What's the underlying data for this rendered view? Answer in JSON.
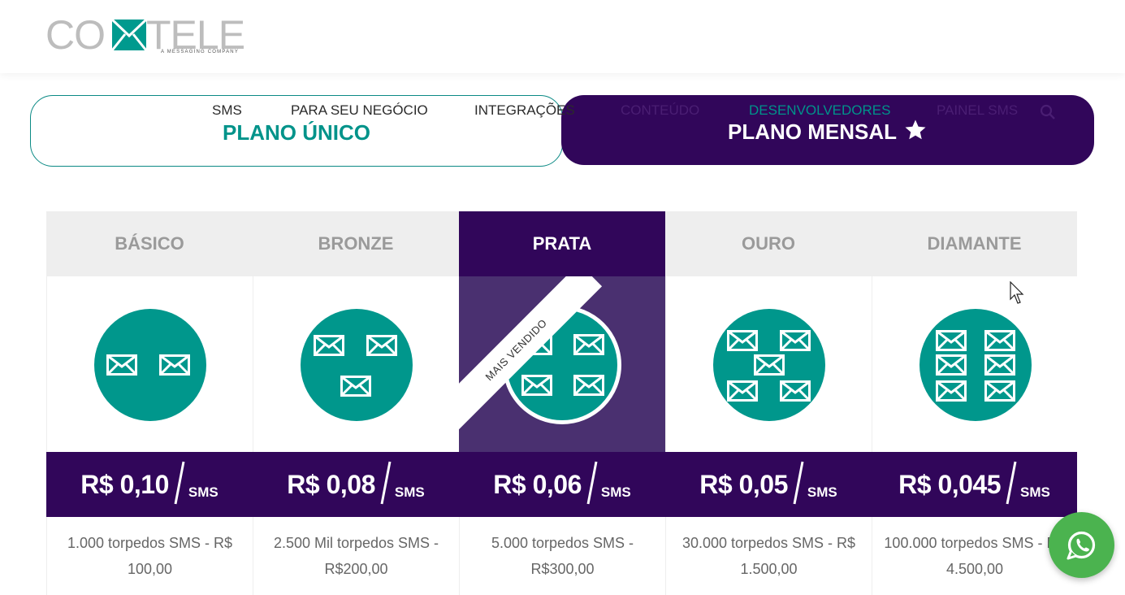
{
  "brand": {
    "logo_left": "CO",
    "logo_right": "TELE",
    "tagline": "A MESSAGING COMPANY",
    "accent": "#009a8e",
    "purple": "#31065a"
  },
  "nav": {
    "items": [
      {
        "label": "SMS"
      },
      {
        "label": "PARA SEU NEGÓCIO"
      },
      {
        "label": "INTEGRAÇÕES"
      },
      {
        "label": "CONTEÚDO"
      },
      {
        "label": "DESENVOLVEDORES"
      },
      {
        "label": "PAINEL SMS"
      }
    ],
    "search_icon": "search-icon"
  },
  "tabs": {
    "unico": "PLANO ÚNICO",
    "mensal": "PLANO MENSAL",
    "mensal_icon": "star-icon"
  },
  "plans": [
    {
      "name": "BÁSICO",
      "price": "R$ 0,10",
      "unit": "SMS",
      "description": "1.000 torpedos SMS - R$ 100,00",
      "envelopes": 2
    },
    {
      "name": "BRONZE",
      "price": "R$ 0,08",
      "unit": "SMS",
      "description": "2.500 Mil torpedos SMS - R$200,00",
      "envelopes": 3
    },
    {
      "name": "PRATA",
      "price": "R$ 0,06",
      "unit": "SMS",
      "description": "5.000 torpedos SMS - R$300,00",
      "envelopes": 4,
      "badge": "MAIS VENDIDO"
    },
    {
      "name": "OURO",
      "price": "R$ 0,05",
      "unit": "SMS",
      "description": "30.000 torpedos SMS - R$ 1.500,00",
      "envelopes": 5
    },
    {
      "name": "DIAMANTE",
      "price": "R$ 0,045",
      "unit": "SMS",
      "description": "100.000 torpedos SMS - R$ 4.500,00",
      "envelopes": 6
    }
  ],
  "whatsapp": {
    "icon": "whatsapp-icon"
  }
}
